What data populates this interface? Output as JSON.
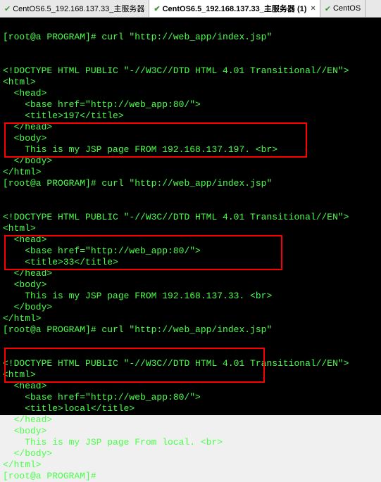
{
  "tabs": {
    "inactive1_label": "CentOS6.5_192.168.137.33_主服务器",
    "active_label": "CentOS6.5_192.168.137.33_主服务器 (1)",
    "inactive2_label": "CentOS",
    "close_glyph": "×",
    "check_glyph": "✔"
  },
  "terminal": {
    "prompt": "[root@a PROGRAM]#",
    "curl_cmd": " curl \"http://web_app/index.jsp\"",
    "blank": "",
    "doctype": "<!DOCTYPE HTML PUBLIC \"-//W3C//DTD HTML 4.01 Transitional//EN\">",
    "html_open": "<html>",
    "head_open": "  <head>",
    "base_href": "    <base href=\"http://web_app:80/\">",
    "title_197": "    <title>197</title>",
    "title_33": "    <title>33</title>",
    "title_local": "    <title>local</title>",
    "head_close": "  </head>",
    "body_open": "  <body>",
    "jsp_197": "    This is my JSP page FROM 192.168.137.197. <br>",
    "jsp_33": "    This is my JSP page FROM 192.168.137.33. <br>",
    "jsp_local": "    This is my JSP page From local. <br>",
    "body_close": "  </body>",
    "html_close": "</html>"
  }
}
